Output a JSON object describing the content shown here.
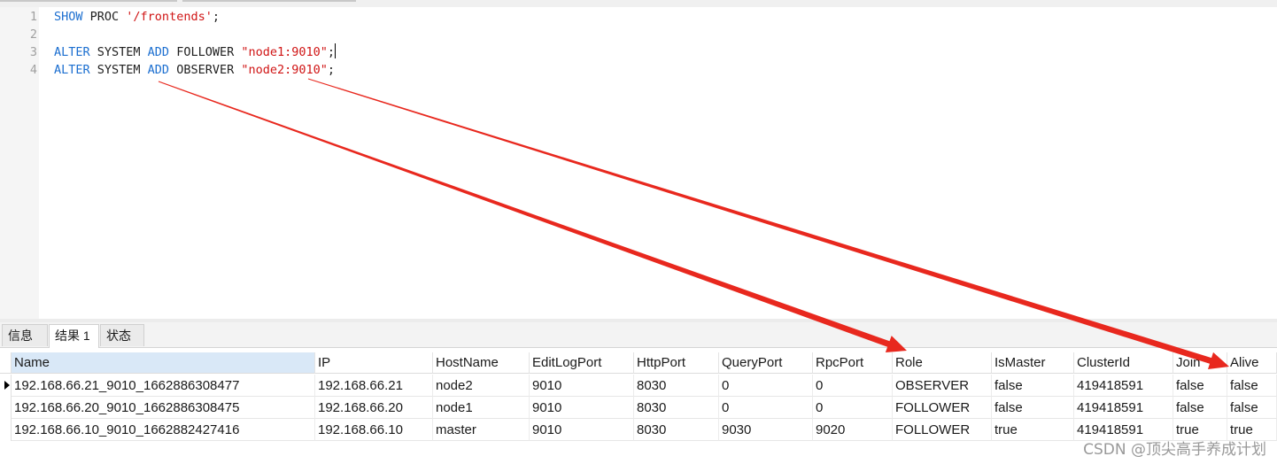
{
  "editor": {
    "lines": [
      {
        "num": "1",
        "tokens": [
          {
            "t": "SHOW",
            "c": "kw"
          },
          {
            "t": " PROC ",
            "c": ""
          },
          {
            "t": "'/frontends'",
            "c": "str"
          },
          {
            "t": ";",
            "c": ""
          }
        ]
      },
      {
        "num": "2",
        "tokens": []
      },
      {
        "num": "3",
        "tokens": [
          {
            "t": "ALTER",
            "c": "kw"
          },
          {
            "t": " SYSTEM ",
            "c": ""
          },
          {
            "t": "ADD",
            "c": "kw"
          },
          {
            "t": " FOLLOWER ",
            "c": ""
          },
          {
            "t": "\"node1:9010\"",
            "c": "str"
          },
          {
            "t": ";",
            "c": ""
          }
        ]
      },
      {
        "num": "4",
        "tokens": [
          {
            "t": "ALTER",
            "c": "kw"
          },
          {
            "t": " SYSTEM ",
            "c": ""
          },
          {
            "t": "ADD",
            "c": "kw"
          },
          {
            "t": " OBSERVER ",
            "c": ""
          },
          {
            "t": "\"node2:9010\"",
            "c": "str"
          },
          {
            "t": ";",
            "c": ""
          }
        ]
      }
    ]
  },
  "tabs": [
    {
      "label": "信息",
      "active": false
    },
    {
      "label": "结果 1",
      "active": true
    },
    {
      "label": "状态",
      "active": false
    }
  ],
  "grid": {
    "columns": [
      "Name",
      "IP",
      "HostName",
      "EditLogPort",
      "HttpPort",
      "QueryPort",
      "RpcPort",
      "Role",
      "IsMaster",
      "ClusterId",
      "Join",
      "Alive"
    ],
    "rows": [
      [
        "192.168.66.21_9010_1662886308477",
        "192.168.66.21",
        "node2",
        "9010",
        "8030",
        "0",
        "0",
        "OBSERVER",
        "false",
        "419418591",
        "false",
        "false"
      ],
      [
        "192.168.66.20_9010_1662886308475",
        "192.168.66.20",
        "node1",
        "9010",
        "8030",
        "0",
        "0",
        "FOLLOWER",
        "false",
        "419418591",
        "false",
        "false"
      ],
      [
        "192.168.66.10_9010_1662882427416",
        "192.168.66.10",
        "master",
        "9010",
        "8030",
        "9030",
        "9020",
        "FOLLOWER",
        "true",
        "419418591",
        "true",
        "true"
      ]
    ],
    "current_row": 0
  },
  "annotation": {
    "arrow_color": "#e8281e"
  },
  "watermark": "CSDN @顶尖高手养成计划"
}
